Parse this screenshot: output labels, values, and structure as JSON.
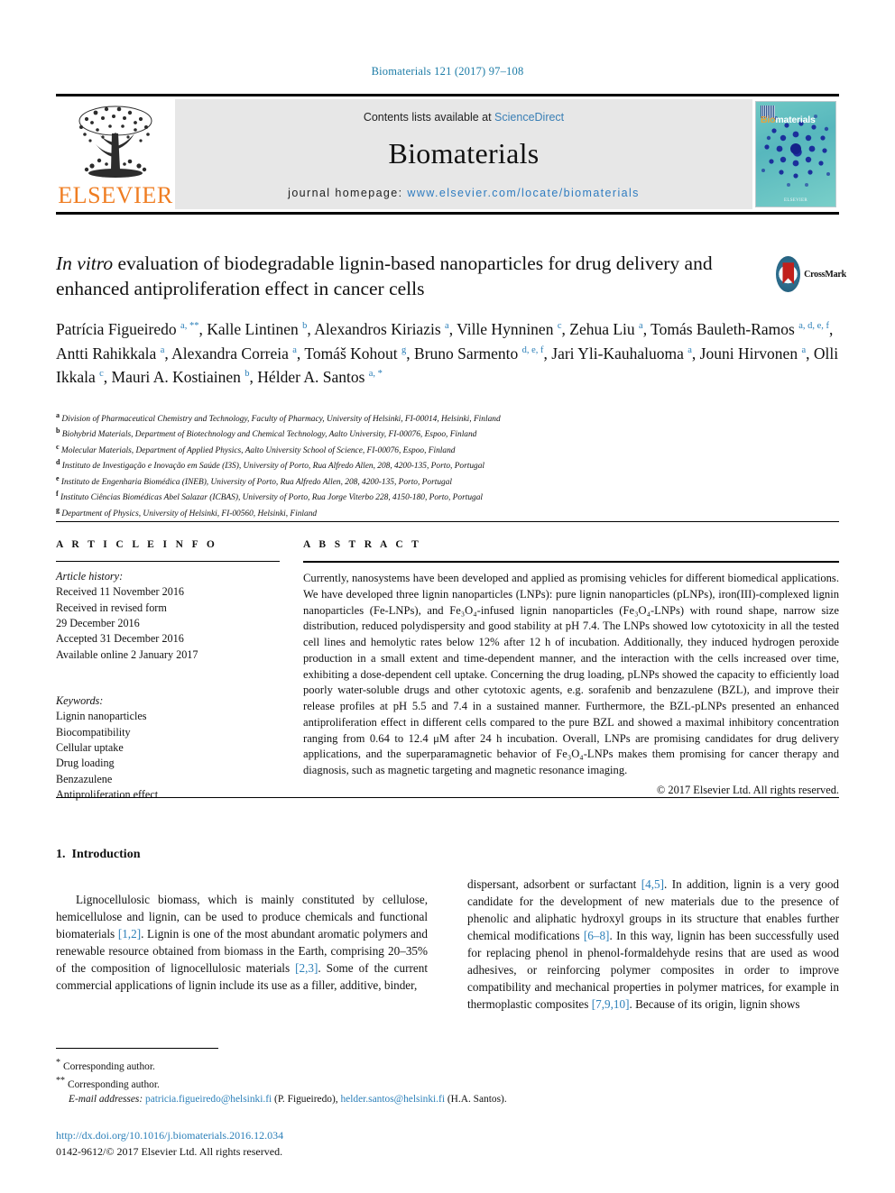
{
  "running_head": "Biomaterials 121 (2017) 97–108",
  "banner": {
    "contents_prefix": "Contents lists available at ",
    "sciencedirect": "ScienceDirect",
    "journal_title": "Biomaterials",
    "homepage_label": "journal homepage: ",
    "homepage_url": "www.elsevier.com/locate/biomaterials",
    "publisher": "ELSEVIER",
    "cover": {
      "title_prefix": "Bio",
      "title_suffix": "materials",
      "footer": "ELSEVIER"
    }
  },
  "article": {
    "title_italic": "In vitro",
    "title_rest": " evaluation of biodegradable lignin-based nanoparticles for drug delivery and enhanced antiproliferation effect in cancer cells",
    "crossmark_label": "CrossMark"
  },
  "authors_html": "Patrícia Figueiredo <sup>a, **</sup>, Kalle Lintinen <sup>b</sup>, Alexandros Kiriazis <sup>a</sup>, Ville Hynninen <sup>c</sup>, Zehua Liu <sup>a</sup>, Tomás Bauleth-Ramos <sup>a, d, e, f</sup>, Antti Rahikkala <sup>a</sup>, Alexandra Correia <sup>a</sup>, Tomáš Kohout <sup>g</sup>, Bruno Sarmento <sup>d, e, f</sup>, Jari Yli-Kauhaluoma <sup>a</sup>, Jouni Hirvonen <sup>a</sup>, Olli Ikkala <sup>c</sup>, Mauri A. Kostiainen <sup>b</sup>, Hélder A. Santos <sup>a, *</sup>",
  "affiliations": [
    {
      "mark": "a",
      "text": "Division of Pharmaceutical Chemistry and Technology, Faculty of Pharmacy, University of Helsinki, FI-00014, Helsinki, Finland"
    },
    {
      "mark": "b",
      "text": "Biohybrid Materials, Department of Biotechnology and Chemical Technology, Aalto University, FI-00076, Espoo, Finland"
    },
    {
      "mark": "c",
      "text": "Molecular Materials, Department of Applied Physics, Aalto University School of Science, FI-00076, Espoo, Finland"
    },
    {
      "mark": "d",
      "text": "Instituto de Investigação e Inovação em Saúde (I3S), University of Porto, Rua Alfredo Allen, 208, 4200-135, Porto, Portugal"
    },
    {
      "mark": "e",
      "text": "Instituto de Engenharia Biomédica (INEB), University of Porto, Rua Alfredo Allen, 208, 4200-135, Porto, Portugal"
    },
    {
      "mark": "f",
      "text": "Instituto Ciências Biomédicas Abel Salazar (ICBAS), University of Porto, Rua Jorge Viterbo 228, 4150-180, Porto, Portugal"
    },
    {
      "mark": "g",
      "text": "Department of Physics, University of Helsinki, FI-00560, Helsinki, Finland"
    }
  ],
  "article_info": {
    "heading": "A R T I C L E   I N F O",
    "history_label": "Article history:",
    "history": [
      "Received 11 November 2016",
      "Received in revised form",
      "29 December 2016",
      "Accepted 31 December 2016",
      "Available online 2 January 2017"
    ],
    "keywords_label": "Keywords:",
    "keywords": [
      "Lignin nanoparticles",
      "Biocompatibility",
      "Cellular uptake",
      "Drug loading",
      "Benzazulene",
      "Antiproliferation effect"
    ]
  },
  "abstract": {
    "heading": "A B S T R A C T",
    "text": "Currently, nanosystems have been developed and applied as promising vehicles for different biomedical applications. We have developed three lignin nanoparticles (LNPs): pure lignin nanoparticles (pLNPs), iron(III)-complexed lignin nanoparticles (Fe-LNPs), and Fe₃O₄-infused lignin nanoparticles (Fe₃O₄-LNPs) with round shape, narrow size distribution, reduced polydispersity and good stability at pH 7.4. The LNPs showed low cytotoxicity in all the tested cell lines and hemolytic rates below 12% after 12 h of incubation. Additionally, they induced hydrogen peroxide production in a small extent and time-dependent manner, and the interaction with the cells increased over time, exhibiting a dose-dependent cell uptake. Concerning the drug loading, pLNPs showed the capacity to efficiently load poorly water-soluble drugs and other cytotoxic agents, e.g. sorafenib and benzazulene (BZL), and improve their release profiles at pH 5.5 and 7.4 in a sustained manner. Furthermore, the BZL-pLNPs presented an enhanced antiproliferation effect in different cells compared to the pure BZL and showed a maximal inhibitory concentration ranging from 0.64 to 12.4 μM after 24 h incubation. Overall, LNPs are promising candidates for drug delivery applications, and the superparamagnetic behavior of Fe₃O₄-LNPs makes them promising for cancer therapy and diagnosis, such as magnetic targeting and magnetic resonance imaging.",
    "copyright": "© 2017 Elsevier Ltd. All rights reserved."
  },
  "body": {
    "section_number": "1.",
    "section_title": "Introduction",
    "left_paragraph_parts": [
      "Lignocellulosic biomass, which is mainly constituted by cellulose, hemicellulose and lignin, can be used to produce chemicals and functional biomaterials ",
      "[1,2]",
      ". Lignin is one of the most abundant aromatic polymers and renewable resource obtained from biomass in the Earth, comprising 20–35% of the composition of lignocellulosic materials ",
      "[2,3]",
      ". Some of the current commercial applications of lignin include its use as a filler, additive, binder,"
    ],
    "right_paragraph_parts": [
      "dispersant, adsorbent or surfactant ",
      "[4,5]",
      ". In addition, lignin is a very good candidate for the development of new materials due to the presence of phenolic and aliphatic hydroxyl groups in its structure that enables further chemical modifications ",
      "[6–8]",
      ". In this way, lignin has been successfully used for replacing phenol in phenol-formaldehyde resins that are used as wood adhesives, or reinforcing polymer composites in order to improve compatibility and mechanical properties in polymer matrices, for example in thermoplastic composites ",
      "[7,9,10]",
      ". Because of its origin, lignin shows"
    ]
  },
  "footnotes": {
    "corresponding_1": "Corresponding author.",
    "corresponding_2": "Corresponding author.",
    "email_label": "E-mail addresses:",
    "email_1": "patricia.figueiredo@helsinki.fi",
    "email_1_name": "(P. Figueiredo),",
    "email_2": "helder.santos@helsinki.fi",
    "email_2_name": "(H.A. Santos).",
    "doi": "http://dx.doi.org/10.1016/j.biomaterials.2016.12.034",
    "issn": "0142-9612/© 2017 Elsevier Ltd. All rights reserved."
  },
  "colors": {
    "link_blue": "#2b7fb8",
    "elsevier_orange": "#ef7d22",
    "crossmark_red": "#c0201c",
    "banner_grey": "#e7e7e7"
  }
}
